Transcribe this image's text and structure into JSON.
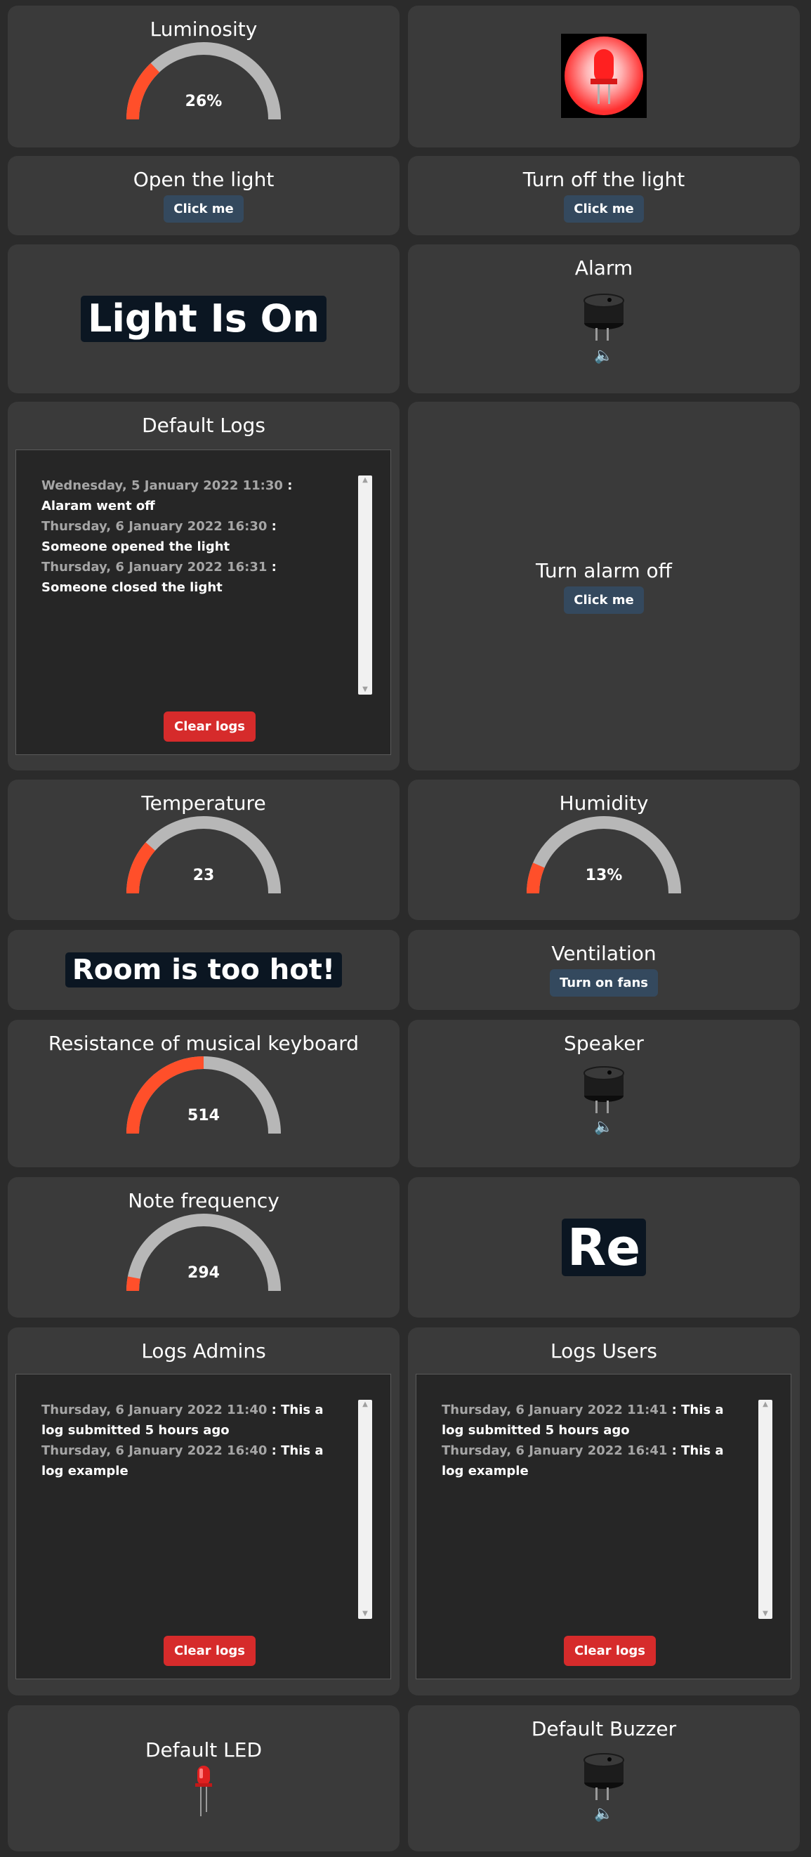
{
  "colors": {
    "page_bg": "#2b2b2b",
    "card_bg": "#3a3a3a",
    "gauge_fill": "#ff4f2a",
    "gauge_track": "#b7b7b7",
    "button_bg": "#34495e",
    "danger_bg": "#d62b2b",
    "banner_bg": "#0b1622"
  },
  "luminosity": {
    "title": "Luminosity",
    "value_text": "26%",
    "fraction": 0.26
  },
  "light_open": {
    "title": "Open the light",
    "button": "Click me"
  },
  "light_off": {
    "title": "Turn off the light",
    "button": "Click me"
  },
  "light_status": {
    "text": "Light Is On"
  },
  "alarm": {
    "title": "Alarm",
    "icon": "buzzer-icon",
    "sound_icon": "speaker-icon"
  },
  "default_logs": {
    "title": "Default Logs",
    "entries": [
      {
        "date": "Wednesday, 5 January 2022 11:30",
        "sep": " : ",
        "msg": "Alaram went off"
      },
      {
        "date": "Thursday, 6 January 2022 16:30",
        "sep": " : ",
        "msg": "Someone opened the light"
      },
      {
        "date": "Thursday, 6 January 2022 16:31",
        "sep": " : ",
        "msg": "Someone closed the light"
      }
    ],
    "clear_button": "Clear logs"
  },
  "alarm_off": {
    "title": "Turn alarm off",
    "button": "Click me"
  },
  "temperature": {
    "title": "Temperature",
    "value_text": "23",
    "fraction": 0.23
  },
  "humidity": {
    "title": "Humidity",
    "value_text": "13%",
    "fraction": 0.13
  },
  "heat_warning": {
    "text": "Room is too hot!"
  },
  "ventilation": {
    "title": "Ventilation",
    "button": "Turn on fans"
  },
  "keyboard_resistance": {
    "title": "Resistance of musical keyboard",
    "value_text": "514",
    "fraction": 0.5
  },
  "speaker": {
    "title": "Speaker",
    "icon": "buzzer-icon",
    "sound_icon": "speaker-icon"
  },
  "note_frequency": {
    "title": "Note frequency",
    "value_text": "294",
    "fraction": 0.06
  },
  "note_display": {
    "text": "Re"
  },
  "logs_admins": {
    "title": "Logs Admins",
    "entries": [
      {
        "date": "Thursday, 6 January 2022 11:40",
        "sep": " : ",
        "msg": "This a log submitted 5 hours ago"
      },
      {
        "date": "Thursday, 6 January 2022 16:40",
        "sep": " : ",
        "msg": "This a log example"
      }
    ],
    "clear_button": "Clear logs"
  },
  "logs_users": {
    "title": "Logs Users",
    "entries": [
      {
        "date": "Thursday, 6 January 2022 11:41",
        "sep": " : ",
        "msg": "This a log submitted 5 hours ago"
      },
      {
        "date": "Thursday, 6 January 2022 16:41",
        "sep": " : ",
        "msg": "This a log example"
      }
    ],
    "clear_button": "Clear logs"
  },
  "default_led": {
    "title": "Default LED",
    "icon": "led-icon"
  },
  "default_buzzer": {
    "title": "Default Buzzer",
    "icon": "buzzer-icon",
    "sound_icon": "speaker-icon"
  }
}
